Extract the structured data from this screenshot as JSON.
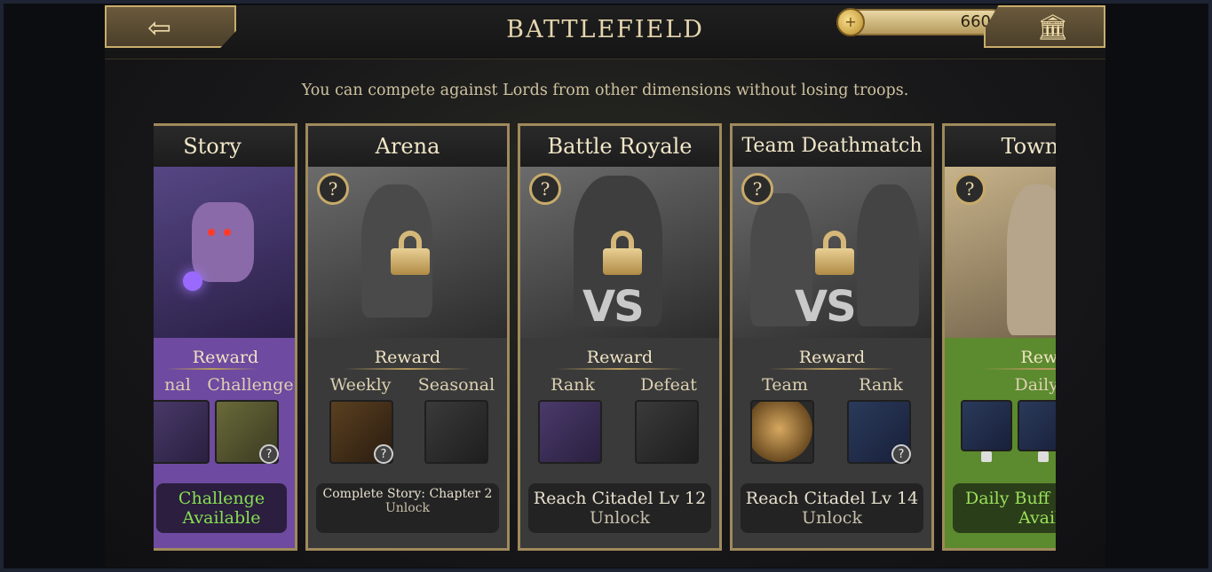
{
  "header": {
    "title": "BATTLEFIELD",
    "currency_value": "660",
    "back_icon": "left-arrow-icon",
    "bank_icon": "bank-icon"
  },
  "subtitle": "You can compete against Lords from other dimensions without losing troops.",
  "cards": [
    {
      "title": "Story",
      "reward_label": "Reward",
      "columns": [
        "nal",
        "Challenge"
      ],
      "requirement_line1": "Challenge",
      "requirement_line2": "Available",
      "locked": false
    },
    {
      "title": "Arena",
      "reward_label": "Reward",
      "columns": [
        "Weekly",
        "Seasonal"
      ],
      "requirement_line1": "Complete Story: Chapter 2",
      "requirement_line2": "Unlock",
      "locked": true
    },
    {
      "title": "Battle Royale",
      "reward_label": "Reward",
      "columns": [
        "Rank",
        "Defeat"
      ],
      "requirement_line1": "Reach Citadel Lv 12",
      "requirement_line2": "Unlock",
      "locked": true,
      "vs_text": "VS"
    },
    {
      "title": "Team Deathmatch",
      "reward_label": "Reward",
      "columns": [
        "Team",
        "Rank"
      ],
      "requirement_line1": "Reach Citadel Lv 14",
      "requirement_line2": "Unlock",
      "locked": true,
      "vs_text": "VS"
    },
    {
      "title": "Town M",
      "reward_label": "Rewa",
      "columns": [
        "Daily I"
      ],
      "requirement_line1": "Daily Buff",
      "requirement_line2": "Availa",
      "locked": false
    }
  ],
  "help_symbol": "?",
  "badge_symbol": "?",
  "colors": {
    "gold": "#c9ac6c",
    "story_purple": "#6e4aa0",
    "town_green": "#5c8a2e",
    "available_text": "#86e052"
  }
}
